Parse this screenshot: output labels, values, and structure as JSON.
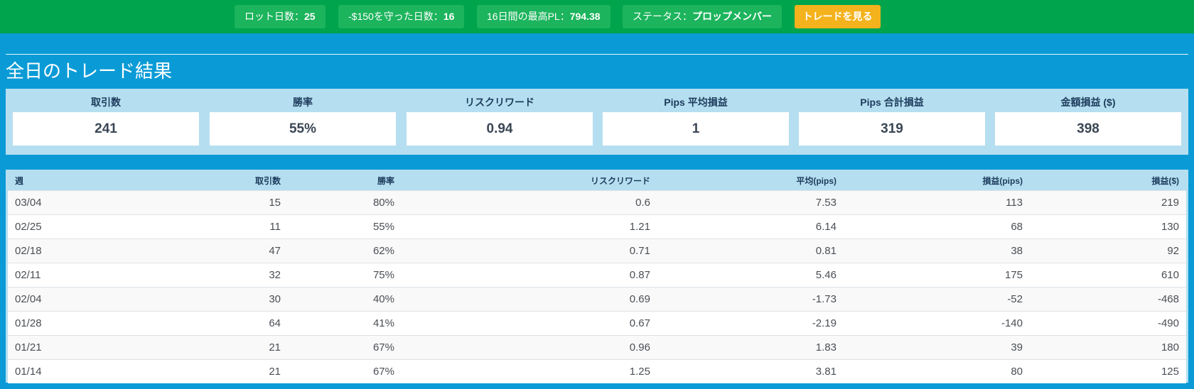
{
  "topbar": {
    "pills": [
      {
        "label": "ロット日数：",
        "value": "25"
      },
      {
        "label": "-$150を守った日数：",
        "value": "16"
      },
      {
        "label": "16日間の最高PL：",
        "value": "794.38"
      },
      {
        "label": "ステータス：",
        "value": "プロップメンバー"
      }
    ],
    "trade_button": "トレードを見る"
  },
  "section_title": "全日のトレード結果",
  "summary": [
    {
      "label": "取引数",
      "value": "241"
    },
    {
      "label": "勝率",
      "value": "55%"
    },
    {
      "label": "リスクリワード",
      "value": "0.94"
    },
    {
      "label": "Pips 平均損益",
      "value": "1"
    },
    {
      "label": "Pips 合計損益",
      "value": "319"
    },
    {
      "label": "金額損益 ($)",
      "value": "398"
    }
  ],
  "table": {
    "headers": [
      "週",
      "取引数",
      "勝率",
      "リスクリワード",
      "平均(pips)",
      "損益(pips)",
      "損益($)"
    ],
    "rows": [
      [
        "03/04",
        "15",
        "80%",
        "0.6",
        "7.53",
        "113",
        "219"
      ],
      [
        "02/25",
        "11",
        "55%",
        "1.21",
        "6.14",
        "68",
        "130"
      ],
      [
        "02/18",
        "47",
        "62%",
        "0.71",
        "0.81",
        "38",
        "92"
      ],
      [
        "02/11",
        "32",
        "75%",
        "0.87",
        "5.46",
        "175",
        "610"
      ],
      [
        "02/04",
        "30",
        "40%",
        "0.69",
        "-1.73",
        "-52",
        "-468"
      ],
      [
        "01/28",
        "64",
        "41%",
        "0.67",
        "-2.19",
        "-140",
        "-490"
      ],
      [
        "01/21",
        "21",
        "67%",
        "0.96",
        "1.83",
        "39",
        "180"
      ],
      [
        "01/14",
        "21",
        "67%",
        "1.25",
        "3.81",
        "80",
        "125"
      ]
    ]
  },
  "colors": {
    "topbar": "#00a44c",
    "pill": "#1cb45c",
    "trade_button": "#f4b21c",
    "page": "#0a9bd6",
    "panel": "#b5dff0"
  }
}
